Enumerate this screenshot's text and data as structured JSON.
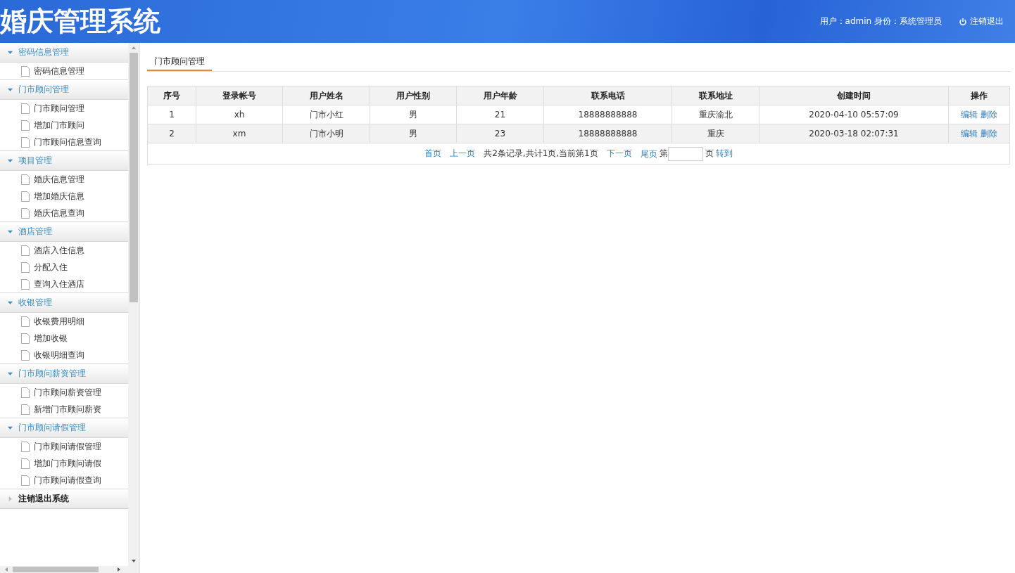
{
  "header": {
    "title": "婚庆管理系统",
    "user_info": "用户：admin 身份：系统管理员",
    "logout": "注销退出"
  },
  "sidebar": {
    "groups": [
      {
        "label": "密码信息管理",
        "expanded": true,
        "items": [
          "密码信息管理"
        ]
      },
      {
        "label": "门市顾问管理",
        "expanded": true,
        "items": [
          "门市顾问管理",
          "增加门市顾问",
          "门市顾问信息查询"
        ]
      },
      {
        "label": "项目管理",
        "expanded": true,
        "items": [
          "婚庆信息管理",
          "增加婚庆信息",
          "婚庆信息查询"
        ]
      },
      {
        "label": "酒店管理",
        "expanded": true,
        "items": [
          "酒店入住信息",
          "分配入住",
          "查询入住酒店"
        ]
      },
      {
        "label": "收银管理",
        "expanded": true,
        "items": [
          "收银费用明细",
          "增加收银",
          "收银明细查询"
        ]
      },
      {
        "label": "门市顾问薪资管理",
        "expanded": true,
        "items": [
          "门市顾问薪资管理",
          "新增门市顾问薪资"
        ]
      },
      {
        "label": "门市顾问请假管理",
        "expanded": true,
        "items": [
          "门市顾问请假管理",
          "增加门市顾问请假",
          "门市顾问请假查询"
        ]
      },
      {
        "label": "注销退出系统",
        "expanded": false
      }
    ]
  },
  "tabs": [
    {
      "label": "门市顾问管理",
      "selected": true
    }
  ],
  "table": {
    "columns": [
      "序号",
      "登录帐号",
      "用户姓名",
      "用户性别",
      "用户年龄",
      "联系电话",
      "联系地址",
      "创建时间",
      "操作"
    ],
    "rows": [
      {
        "cells": [
          "1",
          "xh",
          "门市小红",
          "男",
          "21",
          "18888888888",
          "重庆渝北",
          "2020-04-10 05:57:09"
        ],
        "actions": [
          "编辑",
          "删除"
        ]
      },
      {
        "cells": [
          "2",
          "xm",
          "门市小明",
          "男",
          "23",
          "18888888888",
          "重庆",
          "2020-03-18 02:07:31"
        ],
        "actions": [
          "编辑",
          "删除"
        ]
      }
    ]
  },
  "pagination": {
    "first": "首页",
    "prev": "上一页",
    "summary": "共2条记录,共计1页,当前第1页",
    "next": "下一页",
    "last": "尾页",
    "page_prefix": "第",
    "page_suffix": "页",
    "go": "转到"
  }
}
